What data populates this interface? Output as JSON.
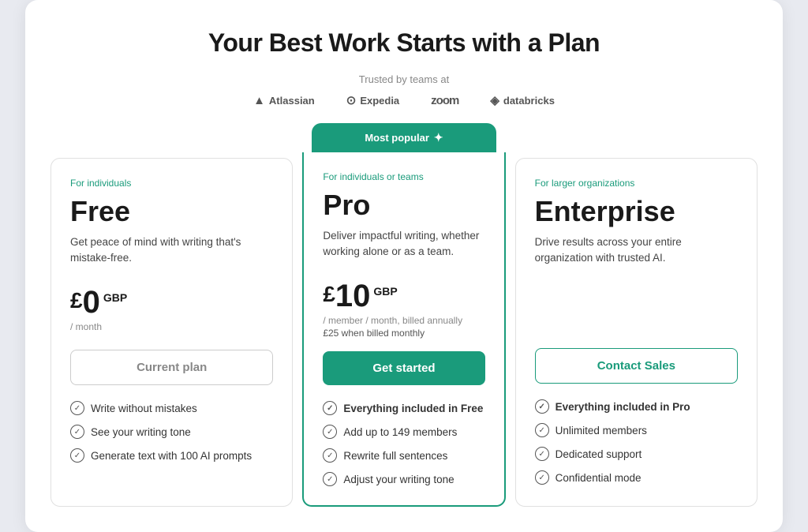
{
  "page": {
    "title": "Your Best Work Starts with a Plan",
    "trusted_label": "Trusted by teams at",
    "logos": [
      {
        "name": "Atlassian",
        "symbol": "▲"
      },
      {
        "name": "Expedia",
        "symbol": "⊙"
      },
      {
        "name": "zoom",
        "symbol": ""
      },
      {
        "name": "databricks",
        "symbol": "◈"
      }
    ]
  },
  "popular_badge": "Most popular",
  "plans": [
    {
      "id": "free",
      "audience": "For individuals",
      "name": "Free",
      "description": "Get peace of mind with writing that's mistake-free.",
      "currency": "£",
      "amount": "0",
      "suffix": "GBP",
      "period": "/ month",
      "monthly_note": "",
      "button_label": "Current plan",
      "button_type": "outline",
      "features": [
        {
          "text": "Write without mistakes",
          "bold": false
        },
        {
          "text": "See your writing tone",
          "bold": false
        },
        {
          "text": "Generate text with 100 AI prompts",
          "bold": false
        }
      ]
    },
    {
      "id": "pro",
      "audience": "For individuals or teams",
      "name": "Pro",
      "description": "Deliver impactful writing, whether working alone or as a team.",
      "currency": "£",
      "amount": "10",
      "suffix": "GBP",
      "period": "/ member / month, billed annually",
      "monthly_note": "£25 when billed monthly",
      "button_label": "Get started",
      "button_type": "primary",
      "features": [
        {
          "text": "Everything included in Free",
          "bold": true
        },
        {
          "text": "Add up to 149 members",
          "bold": false
        },
        {
          "text": "Rewrite full sentences",
          "bold": false
        },
        {
          "text": "Adjust your writing tone",
          "bold": false
        }
      ]
    },
    {
      "id": "enterprise",
      "audience": "For larger organizations",
      "name": "Enterprise",
      "description": "Drive results across your entire organization with trusted AI.",
      "currency": "",
      "amount": "",
      "suffix": "",
      "period": "",
      "monthly_note": "",
      "button_label": "Contact Sales",
      "button_type": "outline-teal",
      "features": [
        {
          "text": "Everything included in Pro",
          "bold": true
        },
        {
          "text": "Unlimited members",
          "bold": false
        },
        {
          "text": "Dedicated support",
          "bold": false
        },
        {
          "text": "Confidential mode",
          "bold": false
        }
      ]
    }
  ]
}
